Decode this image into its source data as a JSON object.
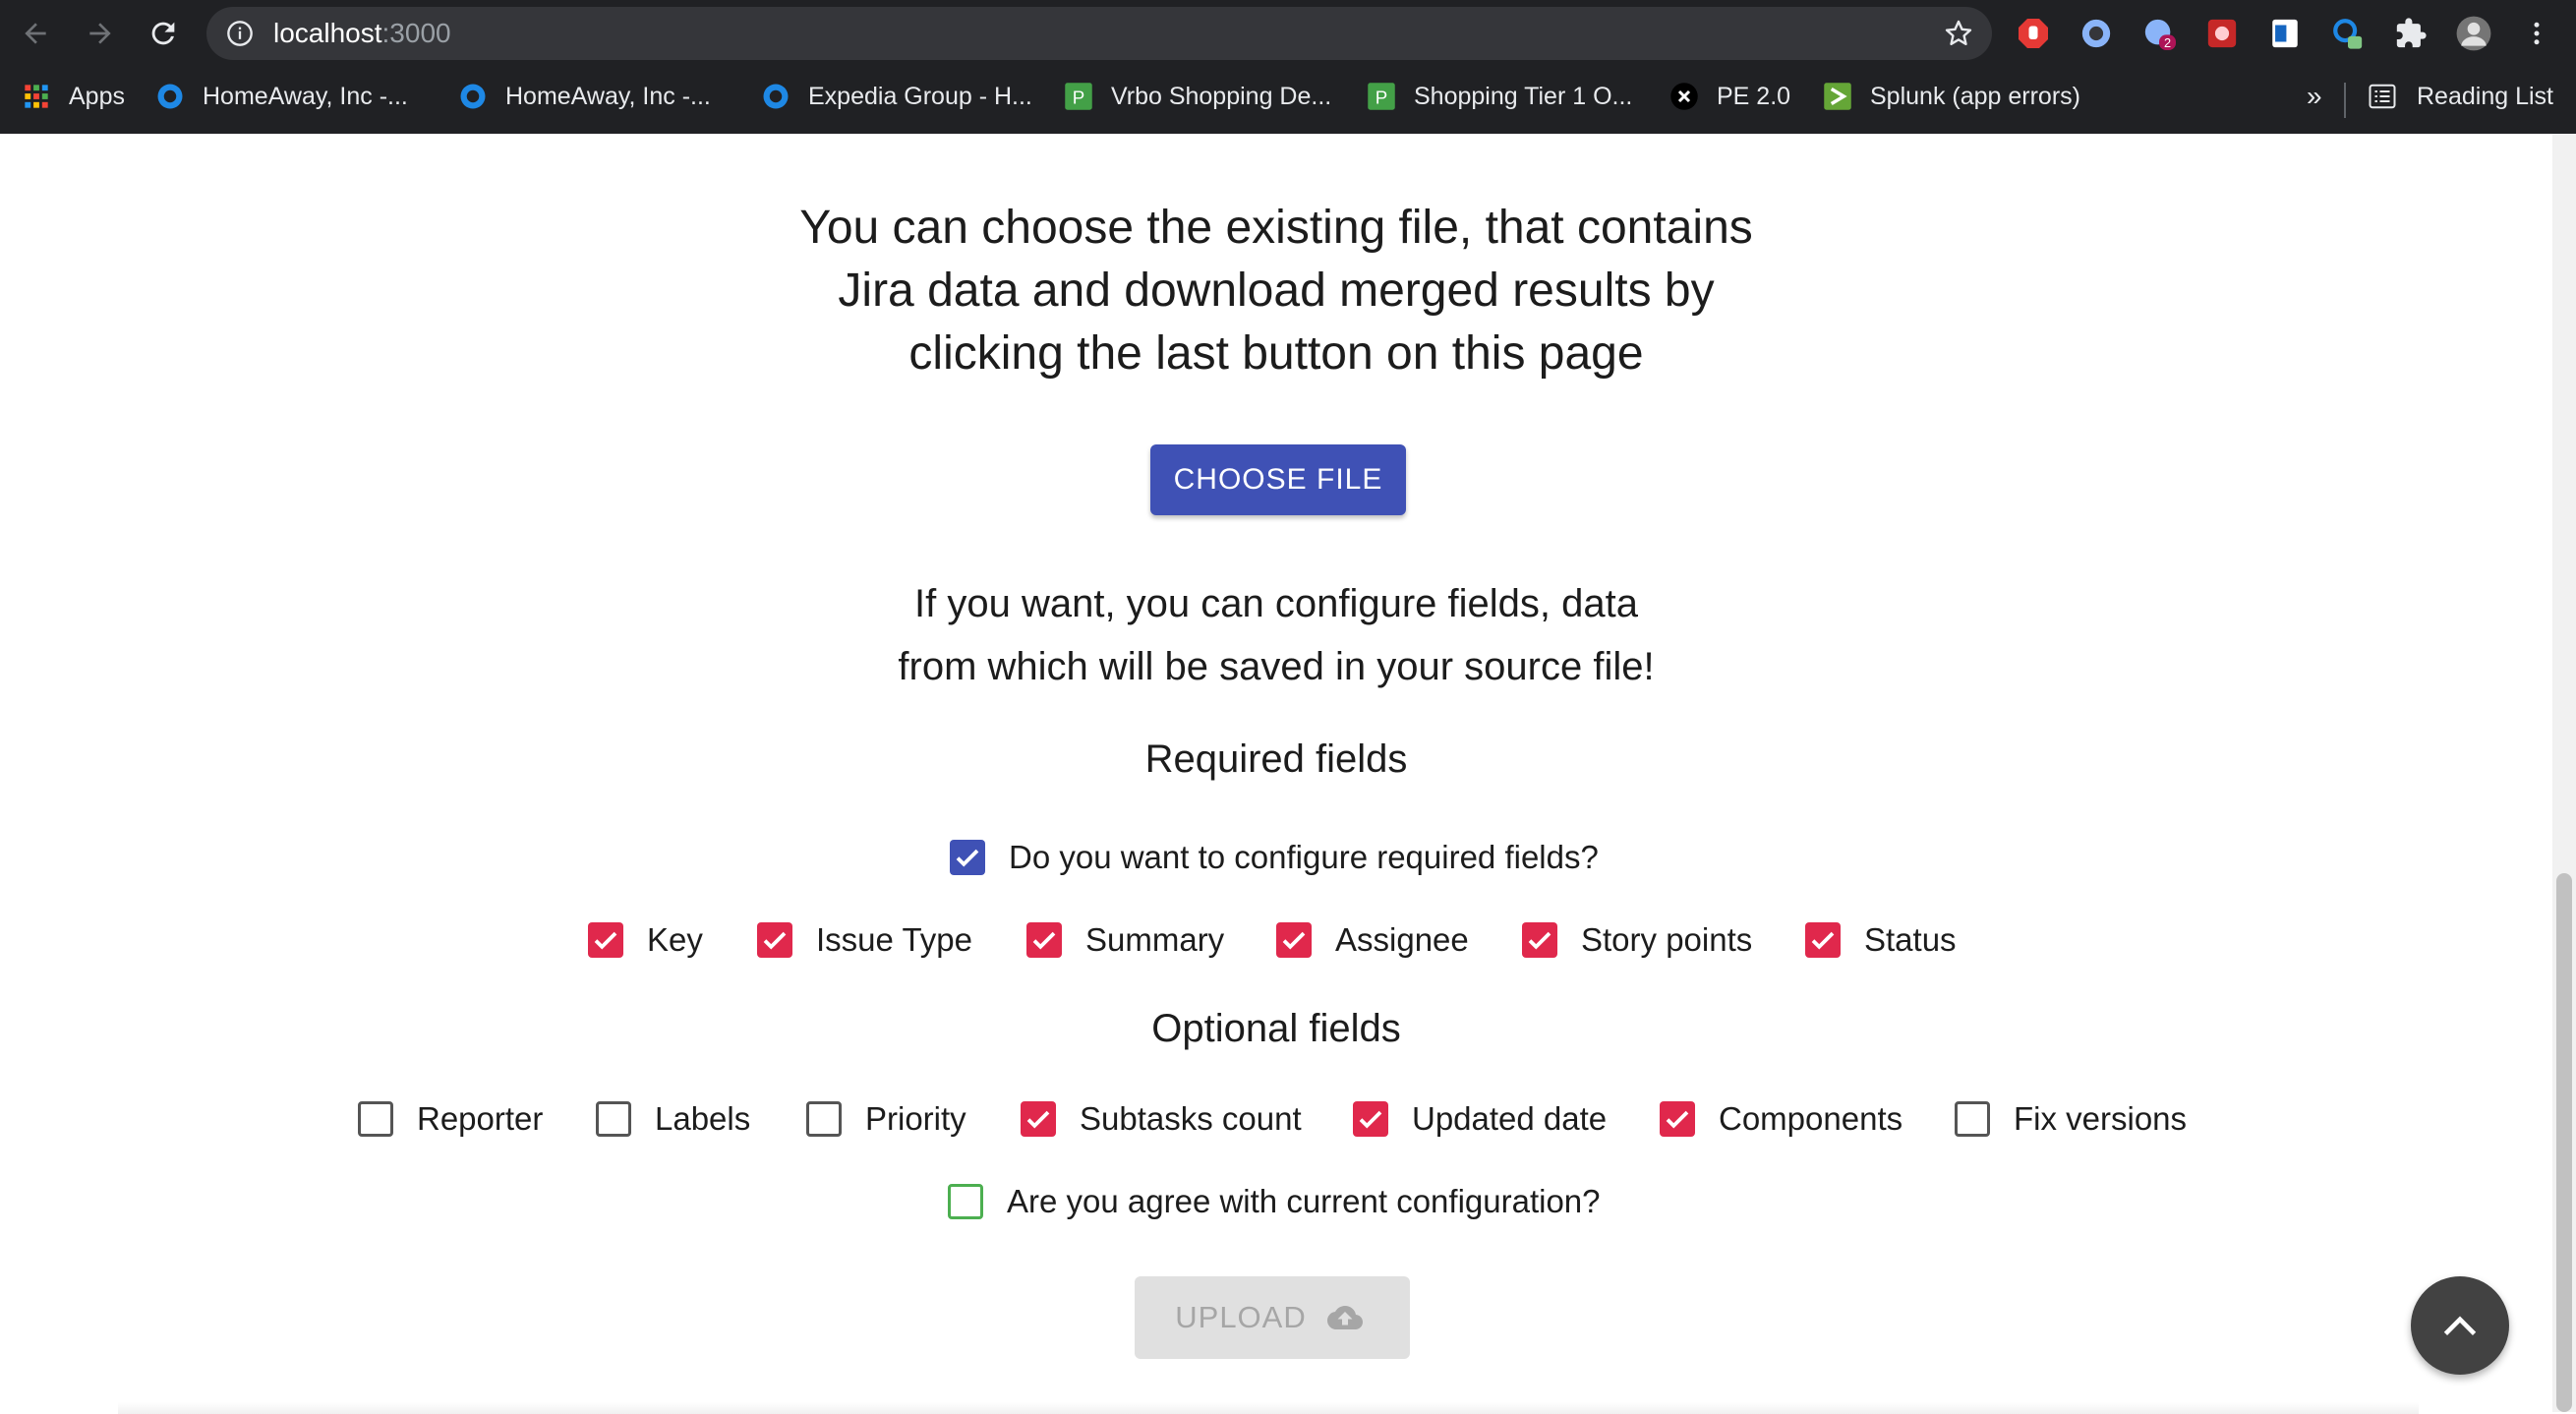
{
  "browser": {
    "url_host": "localhost",
    "url_port": ":3000",
    "bookmarks": [
      {
        "label": "Apps",
        "icon": "apps-grid-icon"
      },
      {
        "label": "HomeAway, Inc -...",
        "icon": "homeaway-icon"
      },
      {
        "label": "HomeAway, Inc -...",
        "icon": "homeaway-icon"
      },
      {
        "label": "Expedia Group - H...",
        "icon": "homeaway-icon"
      },
      {
        "label": "Vrbo Shopping De...",
        "icon": "p-green-icon"
      },
      {
        "label": "Shopping Tier 1 O...",
        "icon": "p-green-icon"
      },
      {
        "label": "PE 2.0",
        "icon": "x-black-icon"
      },
      {
        "label": "Splunk (app errors)",
        "icon": "splunk-icon"
      }
    ],
    "more_label": "»",
    "reading_list": "Reading List",
    "extension_badge": "2"
  },
  "page": {
    "intro_lines": [
      "You can choose the existing file, that contains",
      "Jira data and download merged results by",
      "clicking the last button on this page"
    ],
    "choose_file_label": "CHOOSE FILE",
    "config_lines": [
      "If you want, you can configure fields, data",
      "from which will be saved in your source file!"
    ],
    "required_title": "Required fields",
    "configure_required_question": "Do you want to configure required fields?",
    "required_fields": [
      {
        "label": "Key",
        "checked": true
      },
      {
        "label": "Issue Type",
        "checked": true
      },
      {
        "label": "Summary",
        "checked": true
      },
      {
        "label": "Assignee",
        "checked": true
      },
      {
        "label": "Story points",
        "checked": true
      },
      {
        "label": "Status",
        "checked": true
      }
    ],
    "optional_title": "Optional fields",
    "optional_fields": [
      {
        "label": "Reporter",
        "checked": false
      },
      {
        "label": "Labels",
        "checked": false
      },
      {
        "label": "Priority",
        "checked": false
      },
      {
        "label": "Subtasks count",
        "checked": true
      },
      {
        "label": "Updated date",
        "checked": true
      },
      {
        "label": "Components",
        "checked": true
      },
      {
        "label": "Fix versions",
        "checked": false
      }
    ],
    "agree_question": "Are you agree with current configuration?",
    "upload_label": "UPLOAD",
    "colors": {
      "primary": "#3f51b5",
      "checkbox_checked": "#e0284c",
      "agree_border": "#4caf50",
      "upload_disabled_bg": "#e0e0e0"
    }
  }
}
